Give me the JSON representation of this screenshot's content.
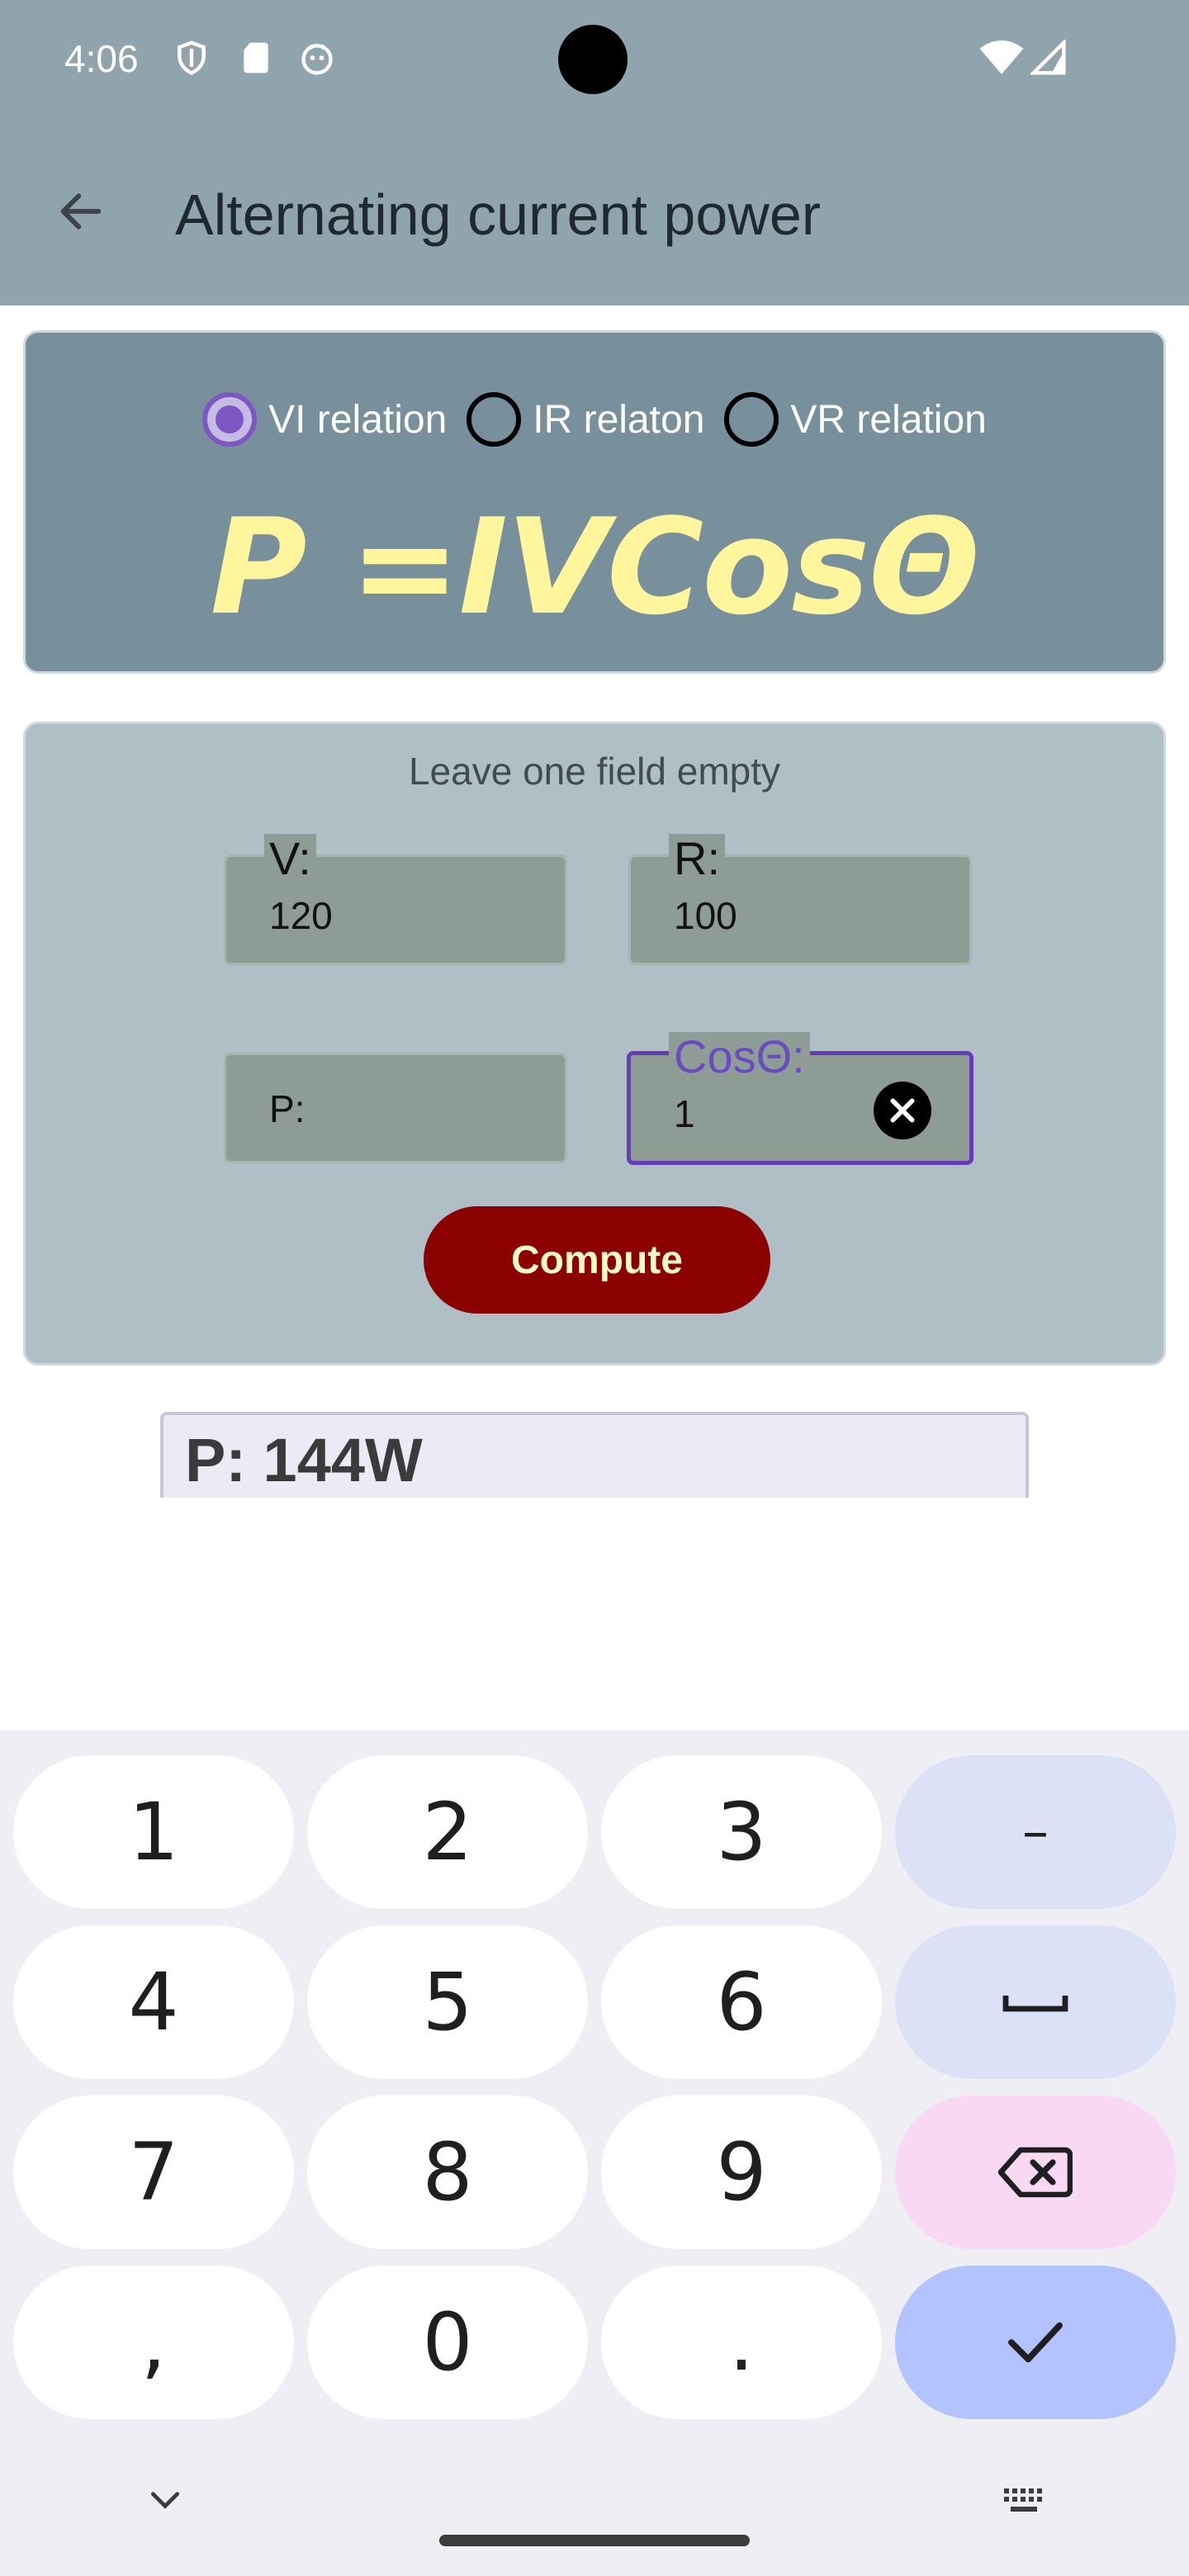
{
  "status_bar": {
    "time": "4:06"
  },
  "app_bar": {
    "title": "Alternating current power"
  },
  "relation_options": [
    {
      "label": "VI relation",
      "selected": true
    },
    {
      "label": "IR relaton",
      "selected": false
    },
    {
      "label": "VR relation",
      "selected": false
    }
  ],
  "formula": "P =IVCosΘ",
  "form": {
    "hint": "Leave one field empty",
    "fields": {
      "v": {
        "label": "V:",
        "value": "120"
      },
      "r": {
        "label": "R:",
        "value": "100"
      },
      "p": {
        "label": "P:",
        "value": ""
      },
      "cos": {
        "label": "CosΘ:",
        "value": "1"
      }
    },
    "compute_label": "Compute"
  },
  "result": "P: 144W",
  "keyboard": {
    "row1": [
      "1",
      "2",
      "3",
      "–"
    ],
    "row2": [
      "4",
      "5",
      "6"
    ],
    "row3": [
      "7",
      "8",
      "9"
    ],
    "row4": [
      ",",
      "0",
      "."
    ]
  },
  "colors": {
    "app_bar": "#90a4ae",
    "formula_card": "#78909c",
    "input_card": "#b0bec5",
    "accent": "#673ab7",
    "compute_button": "#8b0000",
    "formula_text": "#fff59d"
  }
}
